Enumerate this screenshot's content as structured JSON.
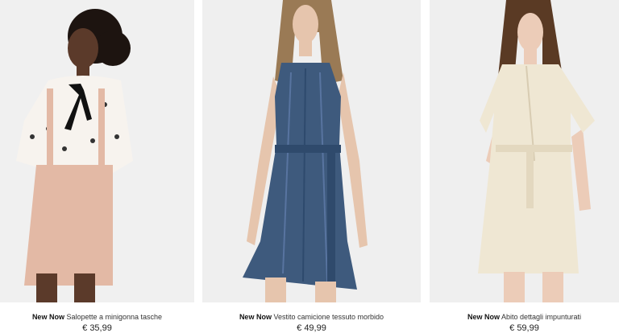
{
  "products": [
    {
      "tag": "New Now",
      "name": "Salopette a minigonna tasche",
      "price": "€ 35,99",
      "colors": {
        "dress": "#e3b9a5",
        "top": "#f7f3ee",
        "skin": "#5b3a2a",
        "hair": "#1d1410"
      }
    },
    {
      "tag": "New Now",
      "name": "Vestito camicione tessuto morbido",
      "price": "€ 49,99",
      "colors": {
        "dress": "#3e5a7d",
        "skin": "#e6c5ad",
        "hair": "#9a7a55"
      }
    },
    {
      "tag": "New Now",
      "name": "Abito dettagli impunturati",
      "price": "€ 59,99",
      "colors": {
        "dress": "#efe7d3",
        "skin": "#ecccb8",
        "hair": "#5a3a24"
      }
    }
  ]
}
